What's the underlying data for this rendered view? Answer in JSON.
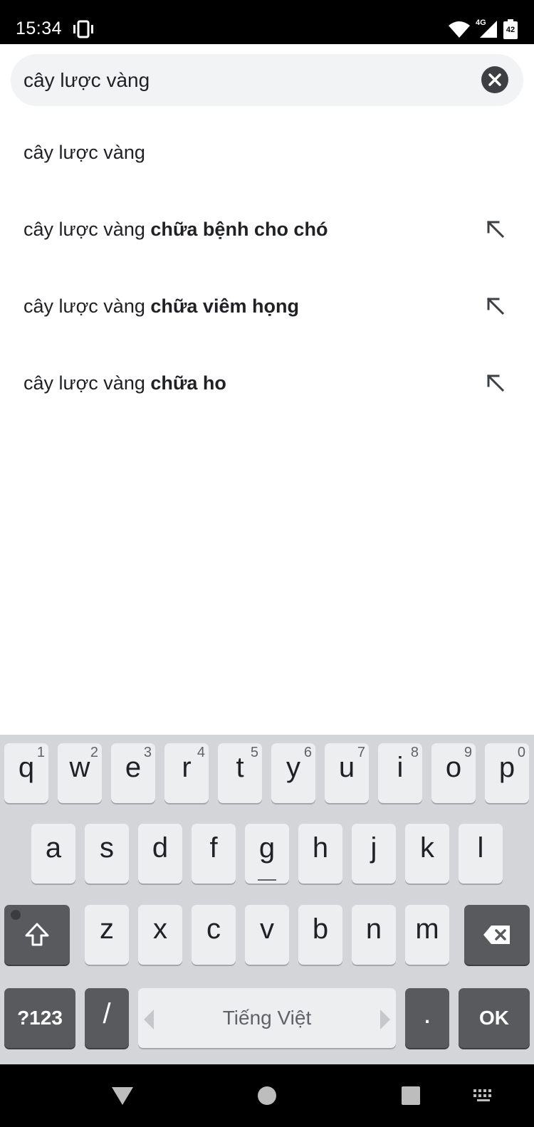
{
  "status_bar": {
    "time": "15:34",
    "network": "4G",
    "battery_level": "42",
    "icons": [
      "vibrate-icon",
      "wifi-icon",
      "signal-icon",
      "battery-icon"
    ]
  },
  "search": {
    "value": "cây lược vàng",
    "clear_icon": "close-circle-icon"
  },
  "suggestions": [
    {
      "prefix": "cây lược vàng",
      "bold": "",
      "has_fill_arrow": false
    },
    {
      "prefix": "cây lược vàng ",
      "bold": "chữa bệnh cho chó",
      "has_fill_arrow": true
    },
    {
      "prefix": "cây lược vàng ",
      "bold": "chữa viêm họng",
      "has_fill_arrow": true
    },
    {
      "prefix": "cây lược vàng ",
      "bold": "chữa ho",
      "has_fill_arrow": true
    }
  ],
  "keyboard": {
    "row1": [
      {
        "ch": "q",
        "hint": "1"
      },
      {
        "ch": "w",
        "hint": "2"
      },
      {
        "ch": "e",
        "hint": "3"
      },
      {
        "ch": "r",
        "hint": "4"
      },
      {
        "ch": "t",
        "hint": "5"
      },
      {
        "ch": "y",
        "hint": "6"
      },
      {
        "ch": "u",
        "hint": "7"
      },
      {
        "ch": "i",
        "hint": "8"
      },
      {
        "ch": "o",
        "hint": "9"
      },
      {
        "ch": "p",
        "hint": "0"
      }
    ],
    "row2": [
      "a",
      "s",
      "d",
      "f",
      "g",
      "h",
      "j",
      "k",
      "l"
    ],
    "row3": [
      "z",
      "x",
      "c",
      "v",
      "b",
      "n",
      "m"
    ],
    "symbols_label": "?123",
    "slash_label": "/",
    "space_label": "Tiếng Việt",
    "period_label": ".",
    "ok_label": "OK"
  },
  "nav_bar": {
    "icons": [
      "back-icon",
      "home-icon",
      "recents-icon",
      "keyboard-switch-icon"
    ]
  },
  "colors": {
    "status_bar": "#000000",
    "search_bg": "#f1f3f4",
    "keyboard_bg": "#d3d5d8",
    "key_light": "#eceeef",
    "key_dark": "#585a5d"
  }
}
